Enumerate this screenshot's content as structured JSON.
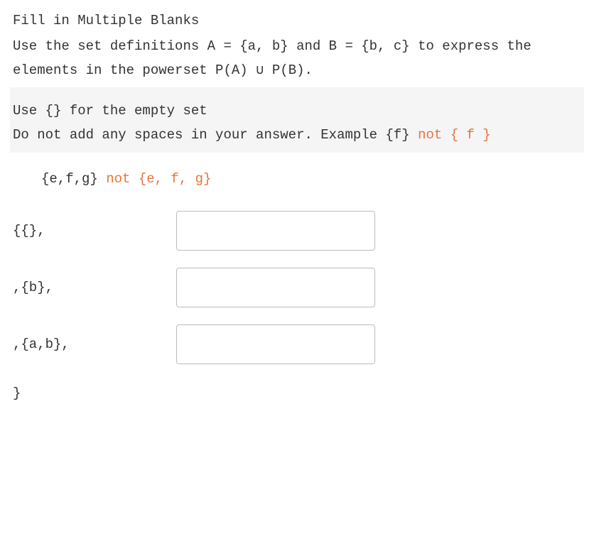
{
  "title": "Fill in Multiple Blanks",
  "prompt": "Use the set definitions A = {a, b} and B = {b, c} to express the elements in the powerset P(A) ∪ P(B).",
  "instructions": {
    "line1": "Use {} for the empty set",
    "line2_part1": "Do not add any spaces in your answer.  Example  {f} ",
    "line2_orange": "not {  f  }"
  },
  "example": {
    "part1": " {e,f,g} ",
    "orange": "not {e, f, g}"
  },
  "blanks": [
    {
      "label": "{{},",
      "value": ""
    },
    {
      "label": ",{b},",
      "value": ""
    },
    {
      "label": ",{a,b},",
      "value": ""
    }
  ],
  "closing": "}"
}
